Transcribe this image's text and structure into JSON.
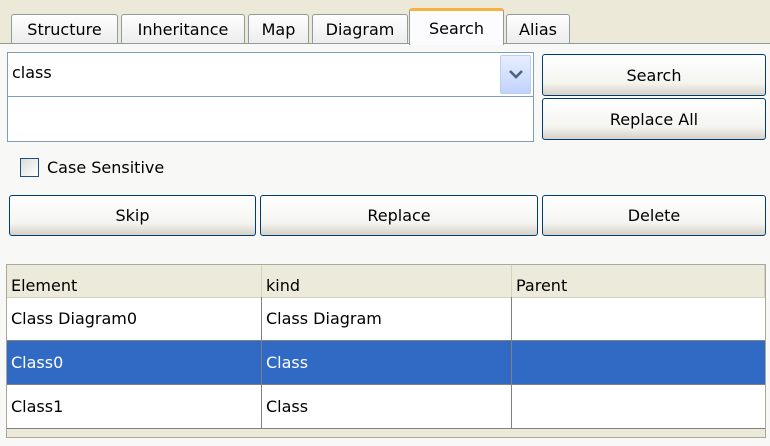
{
  "tabs": [
    "Structure",
    "Inheritance",
    "Map",
    "Diagram",
    "Search",
    "Alias"
  ],
  "active_tab": "Search",
  "search": {
    "query": "class",
    "replace_value": "",
    "search_button": "Search",
    "replace_all_button": "Replace All",
    "case_sensitive_label": "Case Sensitive",
    "case_sensitive_checked": false
  },
  "actions": {
    "skip": "Skip",
    "replace": "Replace",
    "delete": "Delete"
  },
  "results": {
    "columns": [
      "Element",
      "kind",
      "Parent"
    ],
    "rows": [
      {
        "element": "Class Diagram0",
        "kind": "Class Diagram",
        "parent": "",
        "selected": false
      },
      {
        "element": "Class0",
        "kind": "Class",
        "parent": "",
        "selected": true
      },
      {
        "element": "Class1",
        "kind": "Class",
        "parent": "",
        "selected": false
      }
    ]
  },
  "colors": {
    "selection": "#316ac5",
    "active_tab_accent": "#f7b13c",
    "button_border": "#003c74"
  },
  "icons": {
    "combo_dropdown": "chevron-down-icon"
  }
}
